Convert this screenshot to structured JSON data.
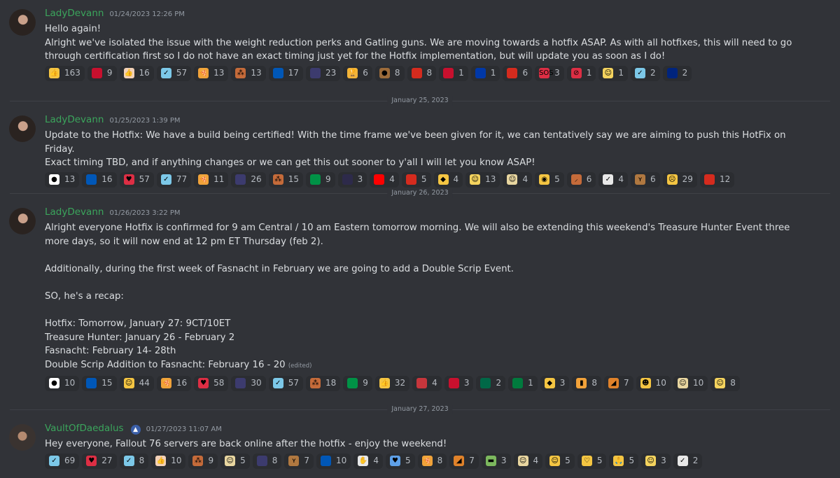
{
  "messages": [
    {
      "author": "LadyDevann",
      "timestamp": "01/24/2023 12:26 PM",
      "lines": [
        "Hello again!",
        "Alright we've isolated the issue with the weight reduction perks and Gatling guns. We are moving towards a hotfix ASAP. As with all hotfixes, this will need to go through certification first so I do not have an exact timing just yet for the Hotfix implementation, but will update you as soon as I do!"
      ],
      "reactions": [
        {
          "emoji": "thumbs-up",
          "glyph": "👍",
          "color": "#f5c542",
          "count": "163"
        },
        {
          "emoji": "flag-hungary",
          "glyph": "",
          "color": "#c8102e",
          "count": "9"
        },
        {
          "emoji": "thumbs-up-light",
          "glyph": "👍",
          "color": "#f2d1b8",
          "count": "16"
        },
        {
          "emoji": "vault-boy",
          "glyph": "✓",
          "color": "#7cc8e8",
          "count": "57"
        },
        {
          "emoji": "pizza",
          "glyph": "🍕",
          "color": "#f0a23a",
          "count": "13"
        },
        {
          "emoji": "tally",
          "glyph": "⁂",
          "color": "#c56b3a",
          "count": "13"
        },
        {
          "emoji": "flag-ukraine",
          "glyph": "",
          "color": "#0057b7",
          "count": "17"
        },
        {
          "emoji": "flag-us",
          "glyph": "",
          "color": "#3c3b6e",
          "count": "23"
        },
        {
          "emoji": "trophy",
          "glyph": "🏆",
          "color": "#f2b33a",
          "count": "6"
        },
        {
          "emoji": "beaver",
          "glyph": "●",
          "color": "#9c6b3a",
          "count": "8"
        },
        {
          "emoji": "flag-canada",
          "glyph": "",
          "color": "#d52b1e",
          "count": "8"
        },
        {
          "emoji": "flag-denmark",
          "glyph": "",
          "color": "#c8102e",
          "count": "1"
        },
        {
          "emoji": "flag-philippines",
          "glyph": "",
          "color": "#0038a8",
          "count": "1"
        },
        {
          "emoji": "flag-russia",
          "glyph": "",
          "color": "#d52b1e",
          "count": "6"
        },
        {
          "emoji": "sos",
          "glyph": "SOS",
          "color": "#dd2e44",
          "count": "3"
        },
        {
          "emoji": "no-entry",
          "glyph": "⊘",
          "color": "#dd2e44",
          "count": "1"
        },
        {
          "emoji": "face",
          "glyph": "☺",
          "color": "#f4d35e",
          "count": "1"
        },
        {
          "emoji": "vault-boy-2",
          "glyph": "✓",
          "color": "#7cc8e8",
          "count": "2"
        },
        {
          "emoji": "flag-new-zealand",
          "glyph": "",
          "color": "#00247d",
          "count": "2"
        }
      ]
    },
    {
      "author": "LadyDevann",
      "timestamp": "01/25/2023 1:39 PM",
      "lines": [
        "Update to the Hotfix: We have a build being certified! With the time frame we've been given for it, we can tentatively say we are aiming to push this HotFix on Friday.",
        "Exact timing TBD, and if anything changes or we can get this out sooner to y'all I will let you know ASAP!"
      ],
      "reactions": [
        {
          "emoji": "flag-japan",
          "glyph": "●",
          "color": "#ffffff",
          "count": "13"
        },
        {
          "emoji": "flag-ukraine",
          "glyph": "",
          "color": "#0057b7",
          "count": "16"
        },
        {
          "emoji": "heart",
          "glyph": "♥",
          "color": "#dd2e44",
          "count": "57"
        },
        {
          "emoji": "vault-boy",
          "glyph": "✓",
          "color": "#7cc8e8",
          "count": "77"
        },
        {
          "emoji": "pizza",
          "glyph": "🍕",
          "color": "#f0a23a",
          "count": "11"
        },
        {
          "emoji": "flag-us",
          "glyph": "",
          "color": "#3c3b6e",
          "count": "26"
        },
        {
          "emoji": "tally",
          "glyph": "⁂",
          "color": "#c56b3a",
          "count": "15"
        },
        {
          "emoji": "flag-italy",
          "glyph": "",
          "color": "#009246",
          "count": "9"
        },
        {
          "emoji": "flag-thailand",
          "glyph": "",
          "color": "#2d2a4a",
          "count": "3"
        },
        {
          "emoji": "flag-taiwan",
          "glyph": "",
          "color": "#fe0000",
          "count": "4"
        },
        {
          "emoji": "flag-canada",
          "glyph": "",
          "color": "#d52b1e",
          "count": "5"
        },
        {
          "emoji": "cheese",
          "glyph": "◆",
          "color": "#f4c542",
          "count": "4"
        },
        {
          "emoji": "face",
          "glyph": "☺",
          "color": "#f4d35e",
          "count": "13"
        },
        {
          "emoji": "face-hat",
          "glyph": "☺",
          "color": "#e8d6a0",
          "count": "4"
        },
        {
          "emoji": "eye",
          "glyph": "◉",
          "color": "#f4c542",
          "count": "5"
        },
        {
          "emoji": "pickaxe",
          "glyph": "⸝",
          "color": "#c56b3a",
          "count": "6"
        },
        {
          "emoji": "vault-boy-arms",
          "glyph": "✓",
          "color": "#e8e8e8",
          "count": "4"
        },
        {
          "emoji": "deer",
          "glyph": "ʏ",
          "color": "#b07840",
          "count": "6"
        },
        {
          "emoji": "sob",
          "glyph": "☹",
          "color": "#f4c542",
          "count": "29"
        },
        {
          "emoji": "flag-russia",
          "glyph": "",
          "color": "#d52b1e",
          "count": "12"
        }
      ]
    },
    {
      "author": "LadyDevann",
      "timestamp": "01/26/2023 3:22 PM",
      "lines": [
        "Alright everyone Hotfix is confirmed for 9 am Central / 10 am Eastern tomorrow morning. We will also be extending this weekend's Treasure Hunter Event three more days, so it will now end at 12 pm ET Thursday (feb 2).",
        "",
        "Additionally, during the first week of Fasnacht in February we are going to add a Double Scrip Event.",
        "",
        "SO, he's a recap:",
        "",
        "Hotfix: Tomorrow, January 27: 9CT/10ET",
        "Treasure Hunter: January 26 - February 2",
        "Fasnacht: February 14- 28th",
        "Double Scrip Addition to Fasnacht: February 16 - 20"
      ],
      "edited_label": "(edited)",
      "reactions": [
        {
          "emoji": "flag-japan",
          "glyph": "●",
          "color": "#ffffff",
          "count": "10"
        },
        {
          "emoji": "flag-ukraine",
          "glyph": "",
          "color": "#0057b7",
          "count": "15"
        },
        {
          "emoji": "partying-face",
          "glyph": "☺",
          "color": "#f4c542",
          "count": "44"
        },
        {
          "emoji": "pizza",
          "glyph": "🍕",
          "color": "#f0a23a",
          "count": "16"
        },
        {
          "emoji": "heart",
          "glyph": "♥",
          "color": "#dd2e44",
          "count": "58"
        },
        {
          "emoji": "flag-us",
          "glyph": "",
          "color": "#3c3b6e",
          "count": "30"
        },
        {
          "emoji": "vault-boy",
          "glyph": "✓",
          "color": "#7cc8e8",
          "count": "57"
        },
        {
          "emoji": "tally",
          "glyph": "⁂",
          "color": "#c56b3a",
          "count": "18"
        },
        {
          "emoji": "flag-italy",
          "glyph": "",
          "color": "#009246",
          "count": "9"
        },
        {
          "emoji": "thumbs-up",
          "glyph": "👍",
          "color": "#f5c542",
          "count": "32"
        },
        {
          "emoji": "flag-serbia",
          "glyph": "",
          "color": "#c6363c",
          "count": "4"
        },
        {
          "emoji": "flag-hungary",
          "glyph": "",
          "color": "#c8102e",
          "count": "3"
        },
        {
          "emoji": "flag-mexico",
          "glyph": "",
          "color": "#006847",
          "count": "2"
        },
        {
          "emoji": "flag-kuwait",
          "glyph": "",
          "color": "#007a3d",
          "count": "1"
        },
        {
          "emoji": "cheese",
          "glyph": "◆",
          "color": "#f4c542",
          "count": "3"
        },
        {
          "emoji": "beer",
          "glyph": "▮",
          "color": "#f2a23a",
          "count": "8"
        },
        {
          "emoji": "pie",
          "glyph": "◢",
          "color": "#e0822a",
          "count": "7"
        },
        {
          "emoji": "cat",
          "glyph": "☻",
          "color": "#f4c542",
          "count": "10"
        },
        {
          "emoji": "face-hat",
          "glyph": "☺",
          "color": "#e8d6a0",
          "count": "10"
        },
        {
          "emoji": "face",
          "glyph": "☺",
          "color": "#f4d35e",
          "count": "8"
        }
      ]
    },
    {
      "author": "VaultOfDaedalus",
      "badge": "▲",
      "timestamp": "01/27/2023 11:07 AM",
      "lines": [
        "Hey everyone, Fallout 76 servers are back online after the hotfix - enjoy the weekend!"
      ],
      "reactions": [
        {
          "emoji": "vault-boy",
          "glyph": "✓",
          "color": "#7cc8e8",
          "count": "69"
        },
        {
          "emoji": "heart",
          "glyph": "♥",
          "color": "#dd2e44",
          "count": "27"
        },
        {
          "emoji": "vault-boy-2",
          "glyph": "✓",
          "color": "#7cc8e8",
          "count": "8"
        },
        {
          "emoji": "thumbs-up-light",
          "glyph": "👍",
          "color": "#f2d1b8",
          "count": "10"
        },
        {
          "emoji": "tally",
          "glyph": "⁂",
          "color": "#c56b3a",
          "count": "9"
        },
        {
          "emoji": "face-hat",
          "glyph": "☺",
          "color": "#e8d6a0",
          "count": "5"
        },
        {
          "emoji": "flag-us",
          "glyph": "",
          "color": "#3c3b6e",
          "count": "8"
        },
        {
          "emoji": "deer",
          "glyph": "ʏ",
          "color": "#b07840",
          "count": "7"
        },
        {
          "emoji": "flag-ukraine",
          "glyph": "",
          "color": "#0057b7",
          "count": "10"
        },
        {
          "emoji": "hand",
          "glyph": "✋",
          "color": "#e8e8e8",
          "count": "4"
        },
        {
          "emoji": "blue-heart",
          "glyph": "♥",
          "color": "#5ea0e8",
          "count": "5"
        },
        {
          "emoji": "pizza",
          "glyph": "🍕",
          "color": "#f0a23a",
          "count": "8"
        },
        {
          "emoji": "pie",
          "glyph": "◢",
          "color": "#e0822a",
          "count": "7"
        },
        {
          "emoji": "money",
          "glyph": "▬",
          "color": "#7cb85e",
          "count": "3"
        },
        {
          "emoji": "face-hat",
          "glyph": "☺",
          "color": "#e8d6a0",
          "count": "4"
        },
        {
          "emoji": "smirk",
          "glyph": "☺",
          "color": "#f4c542",
          "count": "5"
        },
        {
          "emoji": "heart-hands",
          "glyph": "♡",
          "color": "#f4c542",
          "count": "5"
        },
        {
          "emoji": "pray",
          "glyph": "🙏",
          "color": "#f4c542",
          "count": "5"
        },
        {
          "emoji": "face",
          "glyph": "☺",
          "color": "#f4d35e",
          "count": "3"
        },
        {
          "emoji": "vault-boy-arms",
          "glyph": "✓",
          "color": "#e8e8e8",
          "count": "2"
        }
      ]
    }
  ],
  "dividers": [
    "January 25, 2023",
    "January 26, 2023",
    "January 27, 2023"
  ]
}
